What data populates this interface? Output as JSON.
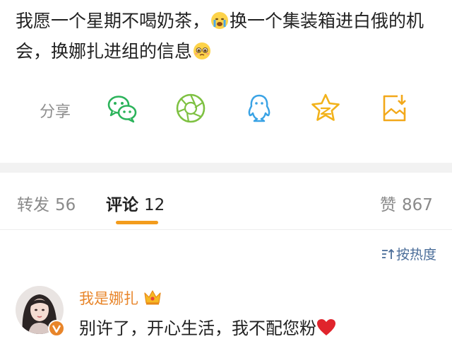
{
  "post": {
    "text_part1": "我愿一个星期不喝奶茶，",
    "emoji1": "crying-face-emoji",
    "text_part2": "换一个集装箱进白俄的机会，换娜扎进组的信息",
    "emoji2": "pleading-face-emoji"
  },
  "share": {
    "label": "分享",
    "icons": [
      "wechat-icon",
      "moments-icon",
      "qq-icon",
      "qzone-icon",
      "save-image-icon"
    ],
    "colors": {
      "wechat": "#2bb35a",
      "moments": "#7ec142",
      "qq": "#3aa3e5",
      "qzone": "#f2b21a",
      "save": "#f2a81a"
    }
  },
  "tabs": {
    "repost": {
      "label": "转发",
      "count": "56"
    },
    "comments": {
      "label": "评论",
      "count": "12"
    },
    "likes": {
      "label": "赞",
      "count": "867"
    },
    "accent_color": "#f39c1d"
  },
  "sort": {
    "label": "按热度",
    "icon": "sort-icon"
  },
  "comment": {
    "username": "我是娜扎",
    "badge": "crown-icon",
    "text": "别许了，开心生活，我不配您粉",
    "emoji": "red-heart-emoji",
    "username_color": "#e8852a"
  }
}
